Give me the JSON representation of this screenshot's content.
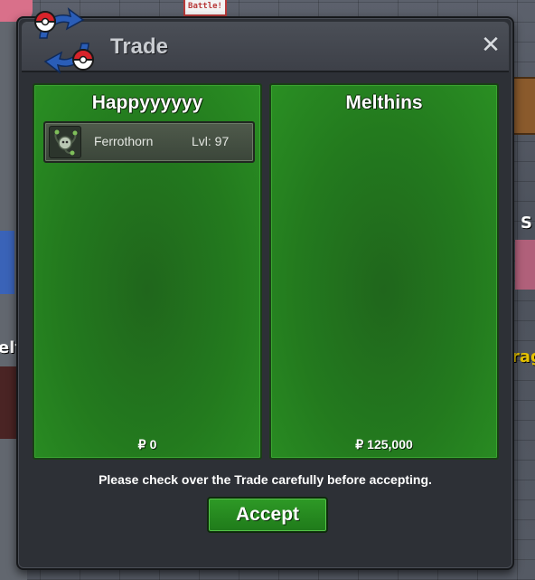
{
  "window": {
    "title": "Trade",
    "close_icon": "close-icon",
    "logo_icon": "trade-arrows-pokeball-icon"
  },
  "background": {
    "sign_text": "Battle!",
    "left_label": "elt",
    "right_label_top": "S",
    "right_label_bottom": "rag"
  },
  "panels": {
    "left": {
      "player_name": "Happyyyyyy",
      "items": [
        {
          "name": "Ferrothorn",
          "level": "Lvl: 97",
          "icon": "pokemon-ferrothorn-icon"
        }
      ],
      "money_symbol": "₽",
      "money": "0"
    },
    "right": {
      "player_name": "Melthins",
      "items": [],
      "money_symbol": "₽",
      "money": "125,000"
    }
  },
  "footer": {
    "message": "Please check over the Trade carefully before accepting.",
    "accept_label": "Accept"
  },
  "colors": {
    "panel_green": "#237a1e",
    "accept_green": "#2e9a26",
    "window_bg": "#2d3036"
  }
}
